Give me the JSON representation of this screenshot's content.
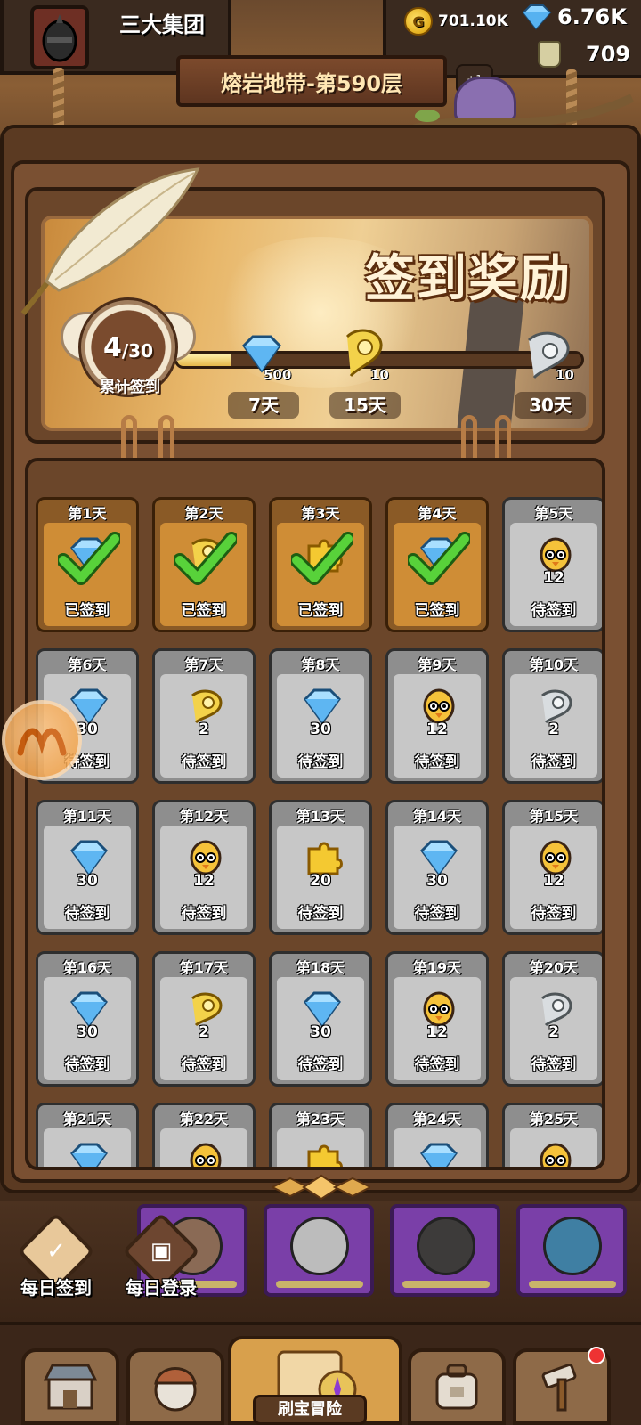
{
  "top_bar": {
    "guild_name": "三大集团",
    "gold": "701.10K",
    "gems": "6.76K",
    "jar": "709"
  },
  "floor": {
    "title": "熔岩地带-第590层",
    "plus_badge": "+1"
  },
  "signin_header": {
    "title": "签到奖励",
    "progress_current": "4",
    "progress_total": "30",
    "progress_fraction": 0.133,
    "progress_label": "累计签到",
    "milestones": [
      {
        "icon": "gem-icon",
        "qty": "500",
        "day": "7天"
      },
      {
        "icon": "gold-scroll-icon",
        "qty": "10",
        "day": "15天"
      },
      {
        "icon": "silver-scroll-icon",
        "qty": "10",
        "day": "30天"
      }
    ]
  },
  "status_labels": {
    "signed": "已签到",
    "pending": "待签到"
  },
  "days": [
    {
      "label": "第1天",
      "icon": "gem-icon",
      "qty": "",
      "signed": true
    },
    {
      "label": "第2天",
      "icon": "gold-scroll-icon",
      "qty": "",
      "signed": true
    },
    {
      "label": "第3天",
      "icon": "puzzle-icon",
      "qty": "",
      "signed": true
    },
    {
      "label": "第4天",
      "icon": "gem-icon",
      "qty": "",
      "signed": true
    },
    {
      "label": "第5天",
      "icon": "hero-chick-icon",
      "qty": "12",
      "signed": false
    },
    {
      "label": "第6天",
      "icon": "gem-icon",
      "qty": "30",
      "signed": false
    },
    {
      "label": "第7天",
      "icon": "gold-scroll-icon",
      "qty": "2",
      "signed": false
    },
    {
      "label": "第8天",
      "icon": "gem-icon",
      "qty": "30",
      "signed": false
    },
    {
      "label": "第9天",
      "icon": "hero-chick-icon",
      "qty": "12",
      "signed": false
    },
    {
      "label": "第10天",
      "icon": "silver-scroll-icon",
      "qty": "2",
      "signed": false
    },
    {
      "label": "第11天",
      "icon": "gem-icon",
      "qty": "30",
      "signed": false
    },
    {
      "label": "第12天",
      "icon": "hero-chick-icon",
      "qty": "12",
      "signed": false
    },
    {
      "label": "第13天",
      "icon": "puzzle-icon",
      "qty": "20",
      "signed": false
    },
    {
      "label": "第14天",
      "icon": "gem-icon",
      "qty": "30",
      "signed": false
    },
    {
      "label": "第15天",
      "icon": "hero-chick-icon",
      "qty": "12",
      "signed": false
    },
    {
      "label": "第16天",
      "icon": "gem-icon",
      "qty": "30",
      "signed": false
    },
    {
      "label": "第17天",
      "icon": "gold-scroll-icon",
      "qty": "2",
      "signed": false
    },
    {
      "label": "第18天",
      "icon": "gem-icon",
      "qty": "30",
      "signed": false
    },
    {
      "label": "第19天",
      "icon": "hero-chick-icon",
      "qty": "12",
      "signed": false
    },
    {
      "label": "第20天",
      "icon": "silver-scroll-icon",
      "qty": "2",
      "signed": false
    },
    {
      "label": "第21天",
      "icon": "gem-icon",
      "qty": "",
      "signed": false
    },
    {
      "label": "第22天",
      "icon": "hero-chick-icon",
      "qty": "",
      "signed": false
    },
    {
      "label": "第23天",
      "icon": "puzzle-icon",
      "qty": "",
      "signed": false
    },
    {
      "label": "第24天",
      "icon": "gem-icon",
      "qty": "",
      "signed": false
    },
    {
      "label": "第25天",
      "icon": "hero-chick-icon",
      "qty": "",
      "signed": false
    }
  ],
  "side_buttons": {
    "daily_signin": "每日签到",
    "daily_login": "每日登录"
  },
  "nav": {
    "active_label": "刷宝冒险"
  },
  "colors": {
    "signed_card": "#cf8d36",
    "pending_card": "#c7c7c7",
    "check_green": "#3fbf2f",
    "hero_card": "#7a3fa8"
  }
}
